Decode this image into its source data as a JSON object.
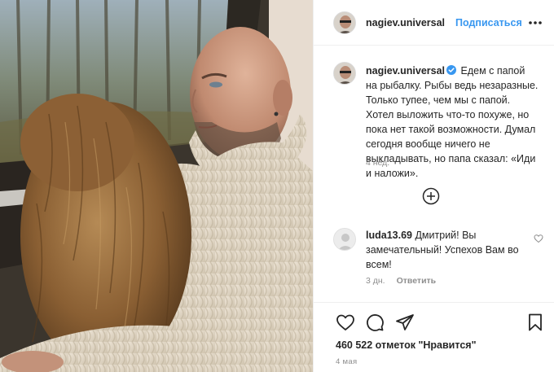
{
  "post": {
    "author": {
      "username": "nagiev.universal",
      "verified": true
    },
    "header": {
      "follow_label": "Подписаться",
      "separator": "•"
    },
    "caption": {
      "text": "Едем с папой на рыбалку. Рыбы ведь незаразные. Только тупее, чем мы с папой. Хотел выложить что-то похуже, но пока нет такой возможности. Думал сегодня вообще ничего не выкладывать, но папа сказал: «Иди и наложи».",
      "time": "4 нед."
    },
    "comments": [
      {
        "username": "luda13.69",
        "text": "Дмитрий! Вы замечательный! Успехов Вам во всем!",
        "time": "3 дн.",
        "reply_label": "Ответить"
      }
    ],
    "likes_text": "460 522 отметок \"Нравится\"",
    "date": "4 мая",
    "icons": {
      "more": "more-horizontal-icon",
      "verified": "verified-badge-icon",
      "load_more": "plus-circle-icon",
      "comment_like": "heart-outline-icon",
      "like": "heart-outline-icon",
      "comment": "speech-bubble-icon",
      "share": "paper-plane-icon",
      "save": "bookmark-icon"
    },
    "colors": {
      "link_blue": "#3897f0",
      "text": "#262626",
      "secondary": "#8e8e8e",
      "border": "#efefef"
    }
  }
}
